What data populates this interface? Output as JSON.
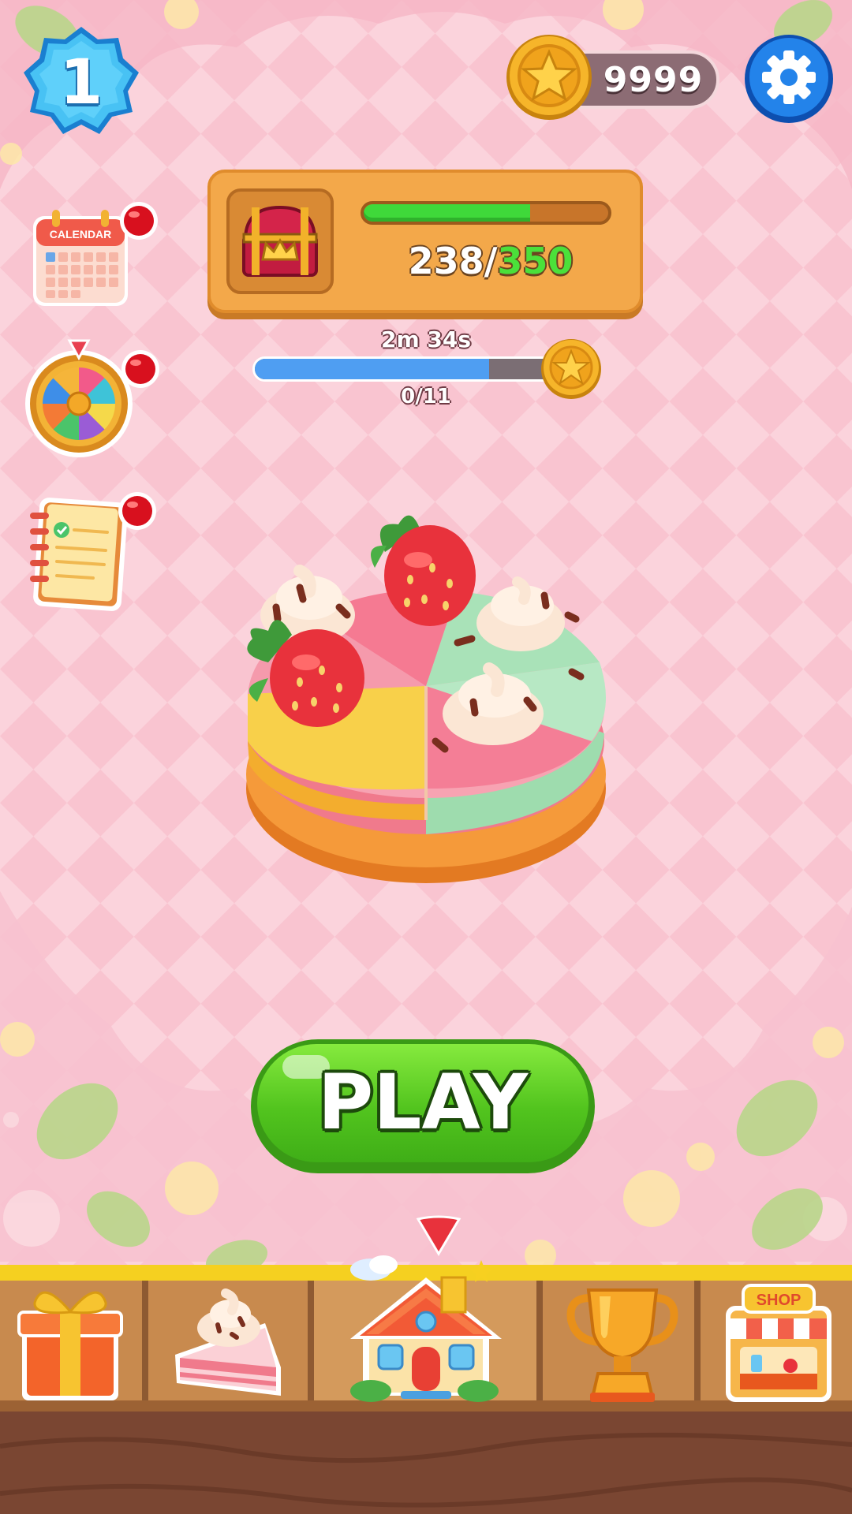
{
  "player": {
    "level": "1"
  },
  "currency": {
    "coins": "9999"
  },
  "chest": {
    "progress_current": "238",
    "progress_separator": "/",
    "progress_goal": "350",
    "fill_fraction": 0.68
  },
  "event": {
    "timer": "2m 34s",
    "progress_text": "0/11",
    "fill_fraction": 0.77
  },
  "calendar": {
    "label": "CALENDAR"
  },
  "play": {
    "label": "PLAY"
  },
  "bottom_nav": {
    "selected": "home",
    "items": [
      {
        "id": "gift",
        "icon": "gift-icon"
      },
      {
        "id": "cake",
        "icon": "cake-slice-icon"
      },
      {
        "id": "home",
        "icon": "house-icon"
      },
      {
        "id": "trophy",
        "icon": "trophy-icon"
      },
      {
        "id": "shop",
        "icon": "shop-icon",
        "label": "SHOP"
      }
    ]
  },
  "notifications": {
    "calendar": true,
    "wheel": true,
    "quests": true
  },
  "colors": {
    "background": "#f9c9d3",
    "panel": "#f3a84a",
    "play_green": "#52c41e",
    "progress_green": "#3fd93a",
    "event_blue": "#4f9ef2",
    "badge_blue": "#3db6f0",
    "settings_blue": "#1f7de0",
    "alert_red": "#d8101e"
  }
}
